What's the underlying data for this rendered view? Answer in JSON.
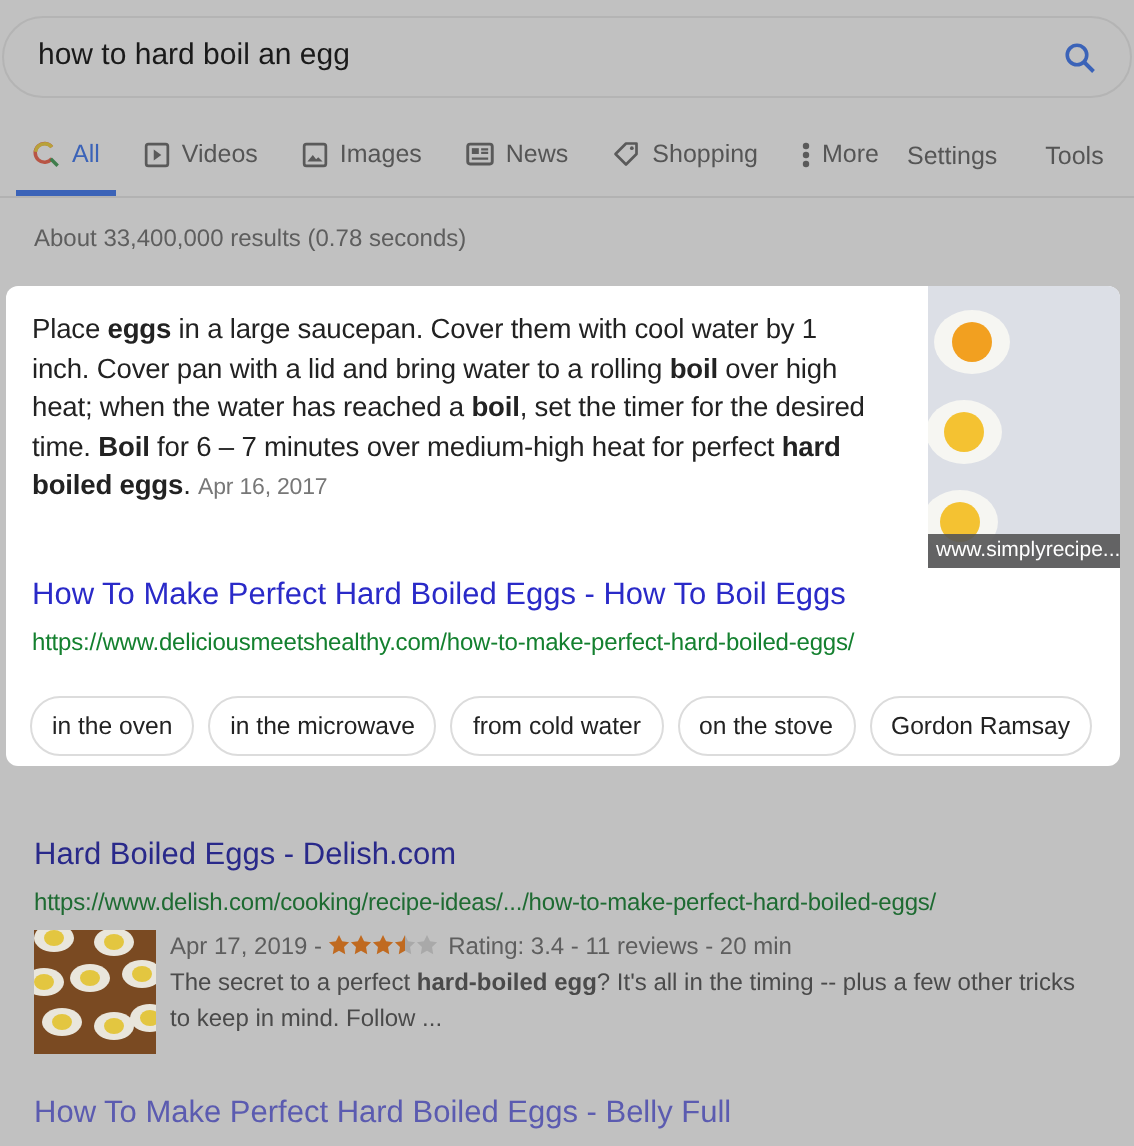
{
  "search": {
    "value": "how to hard boil an egg"
  },
  "tabs": [
    {
      "label": "All",
      "selected": true
    },
    {
      "label": "Videos",
      "selected": false
    },
    {
      "label": "Images",
      "selected": false
    },
    {
      "label": "News",
      "selected": false
    },
    {
      "label": "Shopping",
      "selected": false
    },
    {
      "label": "More",
      "selected": false
    }
  ],
  "tools": [
    "Settings",
    "Tools"
  ],
  "result_stats": "About 33,400,000 results (0.78 seconds)",
  "featured_snippet": {
    "text": "Place **eggs** in a large saucepan. Cover them with cool water by 1 inch. Cover pan with a lid and bring water to a rolling **boil** over high heat; when the water has reached a **boil**, set the timer for the desired time. **Boil** for 6 – 7 minutes over medium-high heat for perfect **hard boiled eggs**.",
    "date": "Apr 16, 2017",
    "image_caption": "www.simplyrecipe...",
    "title": "How To Make Perfect Hard Boiled Eggs - How To Boil Eggs",
    "url": "https://www.deliciousmeetshealthy.com/how-to-make-perfect-hard-boiled-eggs/",
    "chips": [
      "in the oven",
      "in the microwave",
      "from cold water",
      "on the stove",
      "Gordon Ramsay"
    ]
  },
  "results": [
    {
      "title": "Hard Boiled Eggs - Delish.com",
      "url": "https://www.delish.com/cooking/recipe-ideas/.../how-to-make-perfect-hard-boiled-eggs/",
      "date": "Apr 17, 2019 -",
      "stars": 3.5,
      "meta": "Rating: 3.4 - 11 reviews - 20 min",
      "description": "The secret to a perfect **hard-boiled egg**? It's all in the timing -- plus a few other tricks to keep in mind. Follow ..."
    },
    {
      "title": "How To Make Perfect Hard Boiled Eggs - Belly Full"
    }
  ]
}
